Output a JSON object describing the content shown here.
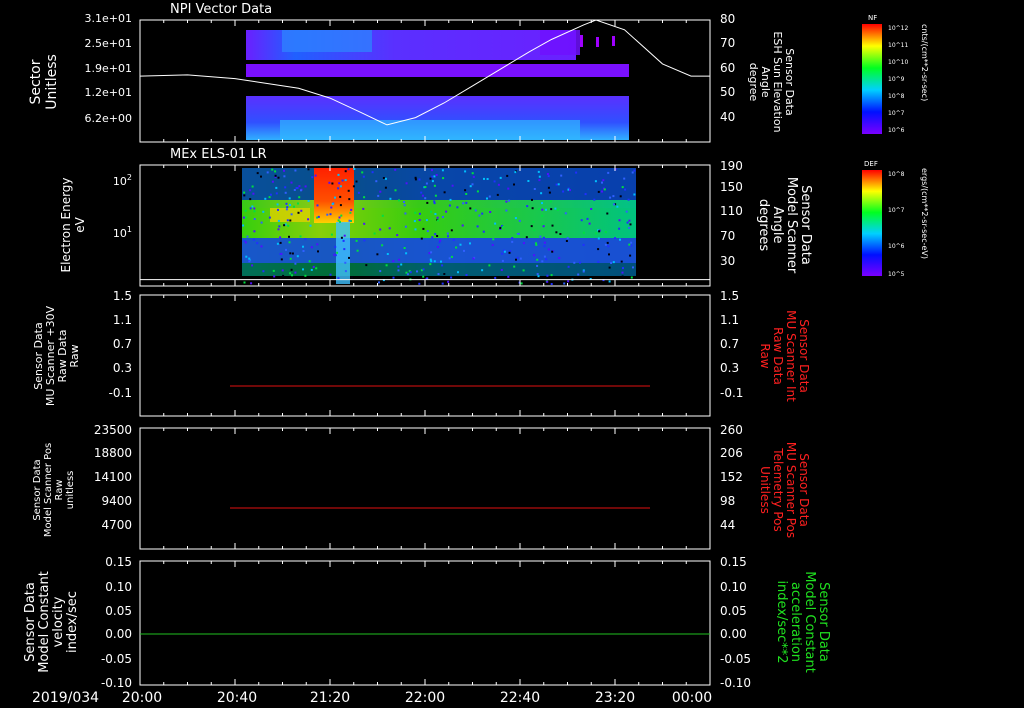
{
  "date_label": "2019/034",
  "x_ticks": [
    "20:00",
    "20:40",
    "21:20",
    "22:00",
    "22:40",
    "23:20",
    "00:00"
  ],
  "colors": {
    "red_axis": "#ff2020",
    "green_axis": "#20e020",
    "trace_white": "#ffffff",
    "trace_red": "#e01010",
    "trace_green": "#20c020"
  },
  "chart_data": [
    {
      "type": "heatmap",
      "title": "NPI Vector Data",
      "ylabel_left": [
        "Sector",
        "Unitless"
      ],
      "yticks_left": [
        "3.1e+01",
        "2.5e+01",
        "1.9e+01",
        "1.2e+01",
        "6.2e+00"
      ],
      "ylabel_right": [
        "Sensor Data",
        "ESH Sun Elevation",
        "Angle",
        "degree"
      ],
      "yticks_right": [
        "80",
        "70",
        "60",
        "50",
        "40"
      ],
      "ylim_right": [
        30,
        80
      ],
      "overlay_line": {
        "x_hours": [
          0,
          0.5,
          1.0,
          1.33,
          1.67,
          2.0,
          2.33,
          2.6,
          2.9,
          3.2,
          3.5,
          3.8,
          4.1,
          4.33,
          4.67,
          4.8,
          5.1,
          5.5,
          5.8,
          6.0
        ],
        "y": [
          57,
          57.5,
          56,
          54,
          52,
          48,
          42,
          37,
          40,
          46,
          53,
          60,
          67,
          72,
          78,
          80,
          76,
          62,
          57,
          57
        ]
      },
      "colorbar": {
        "label": "NF",
        "units": "cnts/(cm**2-sr-sec)",
        "ticks": [
          "10^12",
          "10^11",
          "10^10",
          "10^9",
          "10^8",
          "10^7",
          "10^6"
        ]
      }
    },
    {
      "type": "heatmap",
      "title": "MEx ELS-01 LR",
      "ylabel_left": [
        "Electron Energy",
        "eV"
      ],
      "yticks_left": [
        "10^2",
        "10^1"
      ],
      "ylabel_right": [
        "Sensor Data",
        "Model Scanner",
        "Angle",
        "degrees"
      ],
      "yticks_right": [
        "190",
        "150",
        "110",
        "70",
        "30"
      ],
      "ylim_right": [
        0,
        190
      ],
      "overlay_line": {
        "x_hours": [
          0,
          6.0
        ],
        "y": [
          10,
          10
        ]
      },
      "colorbar": {
        "label": "DEF",
        "units": "ergs/(cm**2-sr-sec-eV)",
        "ticks": [
          "10^8",
          "10^7",
          "10^6",
          "10^5"
        ]
      }
    },
    {
      "type": "line",
      "ylabel_left": [
        "Sensor Data",
        "MU Scanner +30V",
        "Raw Data",
        "Raw"
      ],
      "yticks_left": [
        "1.5",
        "1.1",
        "0.7",
        "0.3",
        "-0.1"
      ],
      "ylim_left": [
        -0.3,
        1.5
      ],
      "ylabel_right": [
        "Sensor Data",
        "MU Scanner Int",
        "Raw Data",
        "Raw"
      ],
      "yticks_right": [
        "1.5",
        "1.1",
        "0.7",
        "0.3",
        "-0.1"
      ],
      "series": [
        {
          "x_hours": [
            0.5,
            5.8
          ],
          "y": [
            -0.02,
            -0.02
          ]
        }
      ]
    },
    {
      "type": "line",
      "ylabel_left": [
        "Sensor Data",
        "Model Scanner Pos",
        "Raw",
        "unitless"
      ],
      "yticks_left": [
        "23500",
        "18800",
        "14100",
        "9400",
        "4700"
      ],
      "ylim_left": [
        0,
        23500
      ],
      "ylabel_right": [
        "Sensor Data",
        "MU Scanner Pos",
        "Telemetry Pos",
        "Unitless"
      ],
      "yticks_right": [
        "260",
        "206",
        "152",
        "98",
        "44"
      ],
      "series": [
        {
          "x_hours": [
            0.5,
            5.8
          ],
          "y": [
            7500,
            7500
          ]
        }
      ]
    },
    {
      "type": "line",
      "ylabel_left": [
        "Sensor Data",
        "Model Constant",
        "velocity",
        "index/sec"
      ],
      "yticks_left": [
        "0.15",
        "0.10",
        "0.05",
        "0.00",
        "-0.05",
        "-0.10"
      ],
      "ylim_left": [
        -0.1,
        0.15
      ],
      "ylabel_right": [
        "Sensor Data",
        "Model Constant",
        "acceleration",
        "index/sec**2"
      ],
      "yticks_right": [
        "0.15",
        "0.10",
        "0.05",
        "0.00",
        "-0.05",
        "-0.10"
      ],
      "series": [
        {
          "x_hours": [
            0,
            6.0
          ],
          "y": [
            0.0,
            0.0
          ]
        }
      ]
    }
  ]
}
